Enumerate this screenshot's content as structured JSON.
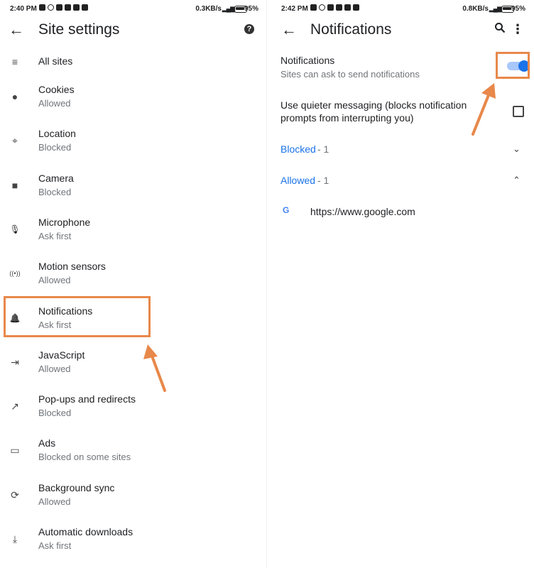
{
  "left": {
    "status": {
      "time": "2:40 PM",
      "speed": "0.3KB/s",
      "battery": "95%"
    },
    "title": "Site settings",
    "items": [
      {
        "title": "All sites",
        "subtitle": "",
        "icon": "list-icon"
      },
      {
        "title": "Cookies",
        "subtitle": "Allowed",
        "icon": "cookie-icon"
      },
      {
        "title": "Location",
        "subtitle": "Blocked",
        "icon": "location-pin-icon"
      },
      {
        "title": "Camera",
        "subtitle": "Blocked",
        "icon": "camera-icon"
      },
      {
        "title": "Microphone",
        "subtitle": "Ask first",
        "icon": "microphone-icon"
      },
      {
        "title": "Motion sensors",
        "subtitle": "Allowed",
        "icon": "motion-sensor-icon"
      },
      {
        "title": "Notifications",
        "subtitle": "Ask first",
        "icon": "bell-icon"
      },
      {
        "title": "JavaScript",
        "subtitle": "Allowed",
        "icon": "javascript-icon"
      },
      {
        "title": "Pop-ups and redirects",
        "subtitle": "Blocked",
        "icon": "popup-icon"
      },
      {
        "title": "Ads",
        "subtitle": "Blocked on some sites",
        "icon": "ads-icon"
      },
      {
        "title": "Background sync",
        "subtitle": "Allowed",
        "icon": "sync-icon"
      },
      {
        "title": "Automatic downloads",
        "subtitle": "Ask first",
        "icon": "download-icon"
      }
    ]
  },
  "right": {
    "status": {
      "time": "2:42 PM",
      "speed": "0.8KB/s",
      "battery": "95%"
    },
    "title": "Notifications",
    "toggle_title": "Notifications",
    "toggle_subtitle": "Sites can ask to send notifications",
    "toggle_on": true,
    "quiet_line1": "Use quieter messaging (blocks notification",
    "quiet_line2": "prompts from interrupting you)",
    "quiet_checked": false,
    "blocked_label": "Blocked",
    "blocked_count": " - 1",
    "allowed_label": "Allowed",
    "allowed_count": " - 1",
    "site_url": "https://www.google.com"
  },
  "colors": {
    "accent": "#1a73e8",
    "highlight": "#e8884a"
  }
}
